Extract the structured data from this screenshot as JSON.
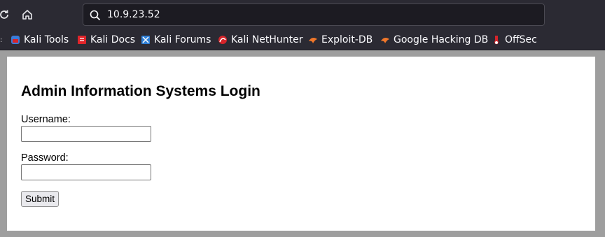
{
  "browser": {
    "url": "10.9.23.52",
    "bookmarks": [
      {
        "label": "Kali Tools",
        "icon": "kali-tools-icon",
        "color": "#3b7bd8"
      },
      {
        "label": "Kali Docs",
        "icon": "kali-docs-icon",
        "color": "#e0242a"
      },
      {
        "label": "Kali Forums",
        "icon": "kali-forums-icon",
        "color": "#2f7fd6"
      },
      {
        "label": "Kali NetHunter",
        "icon": "kali-nethunter-icon",
        "color": "#d6242a"
      },
      {
        "label": "Exploit-DB",
        "icon": "exploit-db-icon",
        "color": "#f0772a"
      },
      {
        "label": "Google Hacking DB",
        "icon": "google-hacking-db-icon",
        "color": "#f0772a"
      },
      {
        "label": "OffSec",
        "icon": "offsec-icon",
        "color": "#d6242a"
      }
    ]
  },
  "page": {
    "title": "Admin Information Systems Login",
    "username_label": "Username:",
    "username_value": "",
    "password_label": "Password:",
    "password_value": "",
    "submit_label": "Submit"
  }
}
